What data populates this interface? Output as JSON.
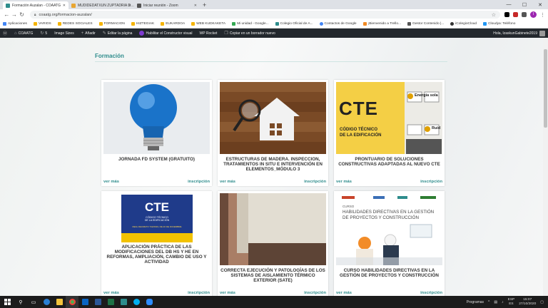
{
  "tabs": [
    {
      "title": "Formación Auzalan - COAATG",
      "favicon": "#2e8c8c",
      "active": true
    },
    {
      "title": "MUDIDEDATXUN ZUPTADRIA D…",
      "favicon": "#e8a531",
      "active": false
    },
    {
      "title": "Iniciar reunión - Zoom",
      "favicon": "#555555",
      "active": false
    }
  ],
  "address": {
    "url": "coaatg.org/formacion-auzalan/"
  },
  "bookmarks": [
    {
      "label": "Aplicaciones",
      "color": "#4285f4"
    },
    {
      "label": "VARIOS",
      "color": "#f5b400"
    },
    {
      "label": "REDES SOCIALES",
      "color": "#f5b400"
    },
    {
      "label": "FORMACION",
      "color": "#f5b400"
    },
    {
      "label": "HIZTEGIAK",
      "color": "#f5b400"
    },
    {
      "label": "EUKARDOA",
      "color": "#f5b400"
    },
    {
      "label": "WEB KUDKAKETA",
      "color": "#f5b400"
    },
    {
      "label": "Mi unidad - Google...",
      "color": "#34a853"
    },
    {
      "label": "Colegio Oficial de A...",
      "color": "#2e8c8c"
    },
    {
      "label": "Contactos de Google",
      "color": "#4285f4"
    },
    {
      "label": "¡Bienvenido a Trello...",
      "color": "#f08a24"
    },
    {
      "label": "Gestor Contenido |...",
      "color": "#555555"
    },
    {
      "label": "iColegioCloud",
      "color": "#333333"
    },
    {
      "label": "Cloudya: Teléfono",
      "color": "#2196f3"
    }
  ],
  "wpbar": {
    "items": [
      "COAATG",
      "5",
      "Image Sizes",
      "Añadir",
      "Editar la página",
      "Habilitar el Constructor visual",
      "WP Rocket",
      "Copiar en un borrador nuevo"
    ],
    "user": "Hola, IzaskunGabinete2019"
  },
  "section": {
    "title": "Formación"
  },
  "cards": [
    {
      "title": "JORNADA FD SYSTEM (GRATUITO)",
      "more": "ver más",
      "signup": "inscripción"
    },
    {
      "title": "ESTRUCTURAS DE MADERA. INSPECCION, TRATAMIENTOS IN SITU E INTERVENCIÓN EN ELEMENTOS_MÓDULO 3",
      "more": "ver más",
      "signup": "inscripción"
    },
    {
      "title": "PRONTUARIO DE SOLUCIONES CONSTRUCTIVAS ADAPTADAS AL NUEVO CTE",
      "more": "ver más",
      "signup": "inscripción",
      "img_text": {
        "big": "CTE",
        "l1": "CÓDIGO TÉCNICO",
        "l2": "DE LA EDIFICACIÓN",
        "energy": "Energía sola",
        "ruid": "Ruid"
      }
    },
    {
      "title": "APLICACIÓN PRÁCTICA DE LAS MODIFICACIONES DEL DB HS Y HE EN REFORMAS, AMPLIACIÓN, CAMBIO DE USO Y ACTIVIDAD",
      "more": "ver más",
      "signup": "inscripción",
      "img_text": {
        "big": "CTE",
        "l1": "CÓDIGO TÉCNICO",
        "l2": "DE LA EDIFICACIÓN",
        "l3": "REAL DECRETO 732/2019, DE 20 DE DICIEMBRE"
      }
    },
    {
      "title": "CORRECTA EJECUCIÓN Y PATOLOGÍAS DE LOS SISTEMAS DE AISLAMIENTO TÉRMICO EXTERIOR (SATE)",
      "more": "ver más",
      "signup": "inscripción"
    },
    {
      "title": "CURSO HABILIDADES DIRECTIVAS EN LA GESTIÓN DE PROYECTOS Y CONSTRUCCIÓN",
      "more": "ver más",
      "signup": "inscripción",
      "img_text": {
        "kicker": "CURSO",
        "l1": "HABILIDADES DIRECTIVAS EN LA GESTIÓN",
        "l2": "DE PROYECTOS Y CONSTRUCCIÓN"
      }
    }
  ],
  "taskbar": {
    "search_label": "Programas",
    "lang": "ESP",
    "lang2": "ES",
    "time": "15:07",
    "date": "27/10/2020"
  }
}
